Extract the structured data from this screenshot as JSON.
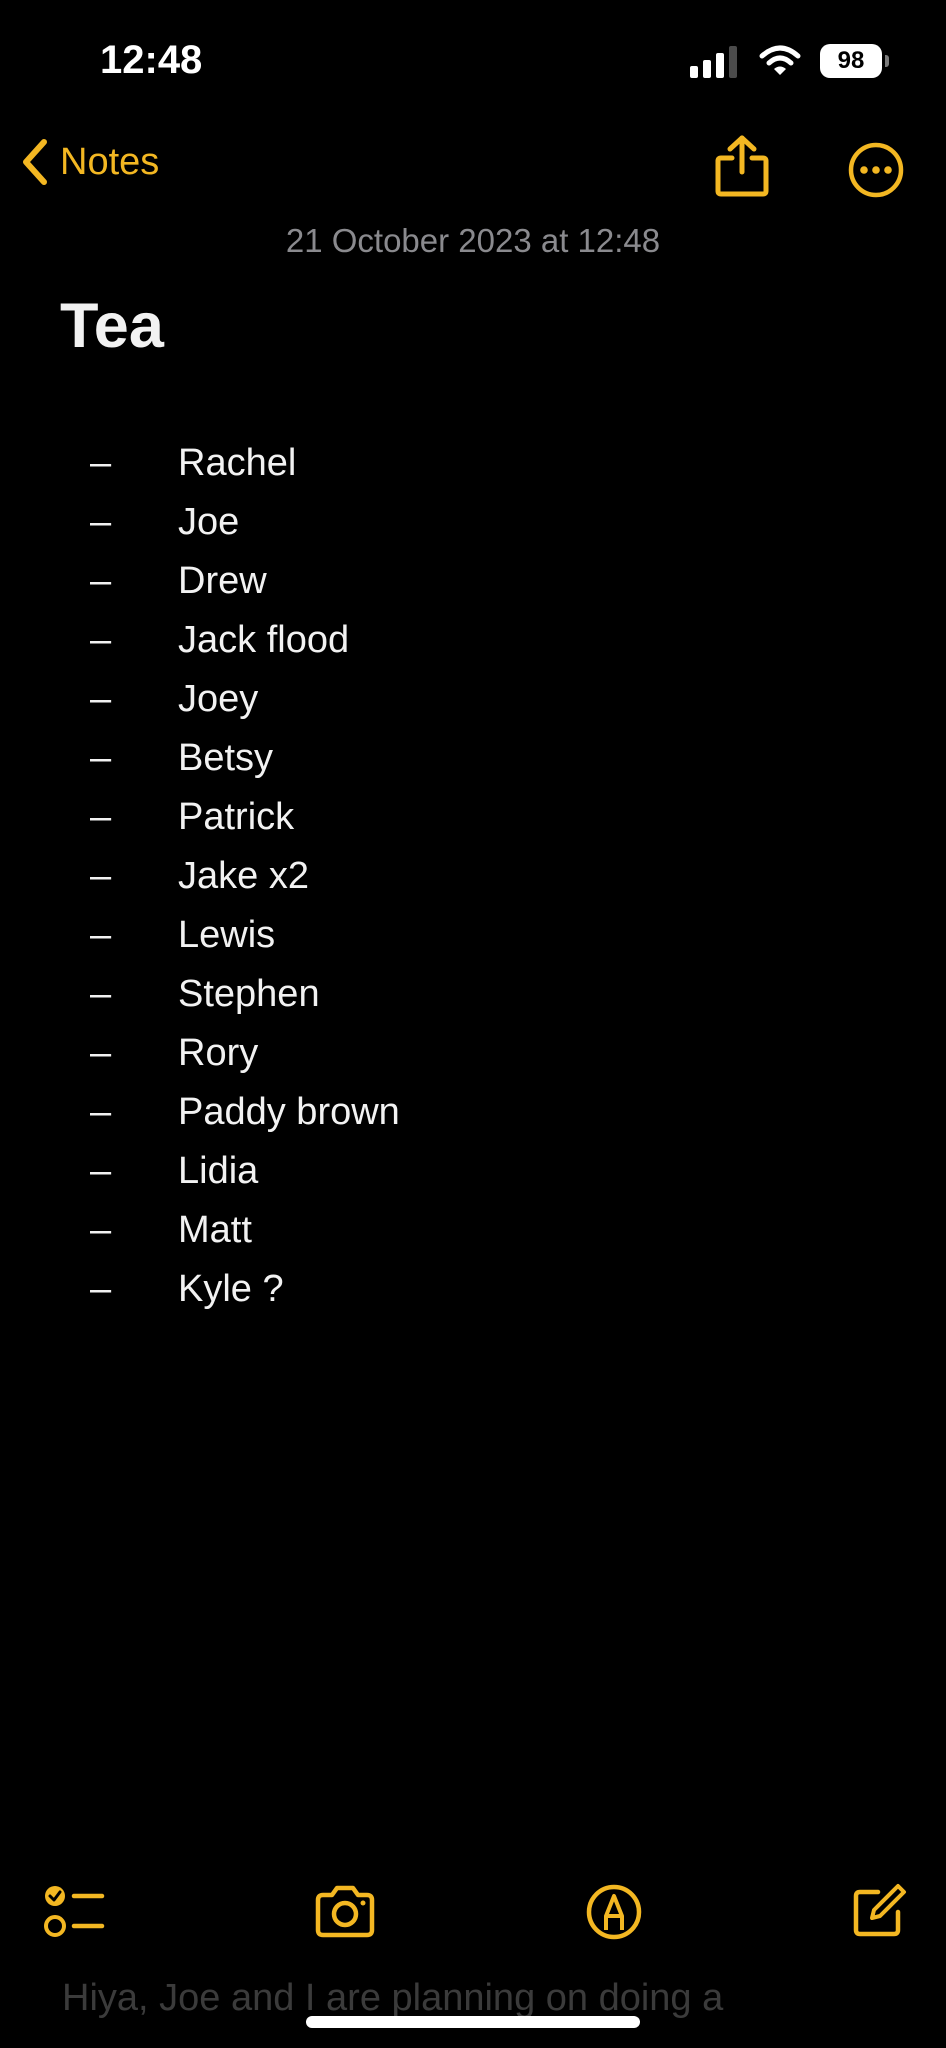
{
  "status_bar": {
    "time": "12:48",
    "battery": "98",
    "icons": [
      "signal-icon",
      "wifi-icon",
      "battery-icon"
    ]
  },
  "nav": {
    "back_label": "Notes",
    "accent": "#f3b722"
  },
  "note": {
    "date": "21 October 2023 at 12:48",
    "title": "Tea",
    "items": [
      "Rachel",
      "Joe",
      "Drew",
      "Jack flood",
      "Joey",
      "Betsy",
      "Patrick",
      "Jake x2",
      "Lewis",
      "Stephen",
      "Rory",
      "Paddy brown",
      "Lidia",
      "Matt",
      "Kyle ?"
    ],
    "bullet": "–"
  },
  "toolbar": {
    "icons": [
      "checklist-icon",
      "camera-icon",
      "markup-icon",
      "compose-icon"
    ]
  },
  "faint_preview": "Hiya, Joe and I are planning on doing a"
}
